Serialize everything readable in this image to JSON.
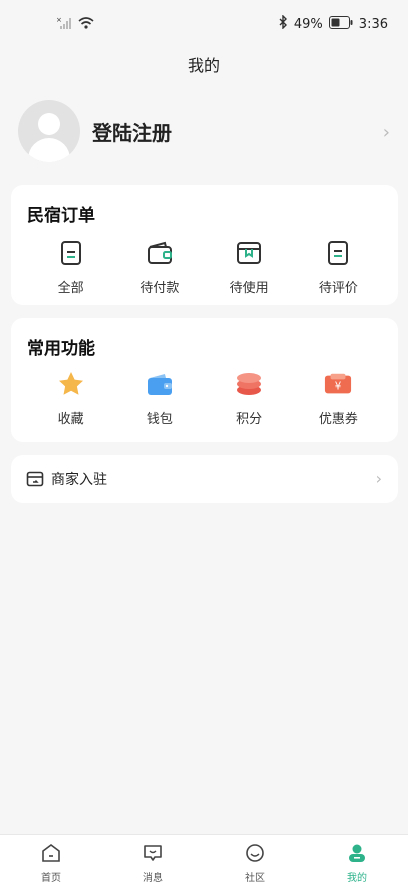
{
  "status_bar": {
    "battery": "49%",
    "time": "3:36",
    "signal_icon": "signal-icon",
    "wifi_icon": "wifi-icon",
    "bluetooth_icon": "bluetooth-icon"
  },
  "header": {
    "title": "我的"
  },
  "profile": {
    "login_label": "登陆注册"
  },
  "orders": {
    "title": "民宿订单",
    "items": [
      {
        "label": "全部",
        "icon": "document-icon"
      },
      {
        "label": "待付款",
        "icon": "wallet-icon"
      },
      {
        "label": "待使用",
        "icon": "box-icon"
      },
      {
        "label": "待评价",
        "icon": "review-icon"
      }
    ]
  },
  "functions": {
    "title": "常用功能",
    "items": [
      {
        "label": "收藏",
        "icon": "star-icon"
      },
      {
        "label": "钱包",
        "icon": "wallet-icon"
      },
      {
        "label": "积分",
        "icon": "coins-icon"
      },
      {
        "label": "优惠券",
        "icon": "coupon-icon"
      }
    ]
  },
  "merchant": {
    "label": "商家入驻",
    "icon": "store-icon"
  },
  "tabbar": {
    "items": [
      {
        "label": "首页",
        "icon": "home-icon"
      },
      {
        "label": "消息",
        "icon": "message-icon"
      },
      {
        "label": "社区",
        "icon": "smile-icon"
      },
      {
        "label": "我的",
        "icon": "user-icon"
      }
    ],
    "active": "我的",
    "accent": "#2db28a"
  }
}
